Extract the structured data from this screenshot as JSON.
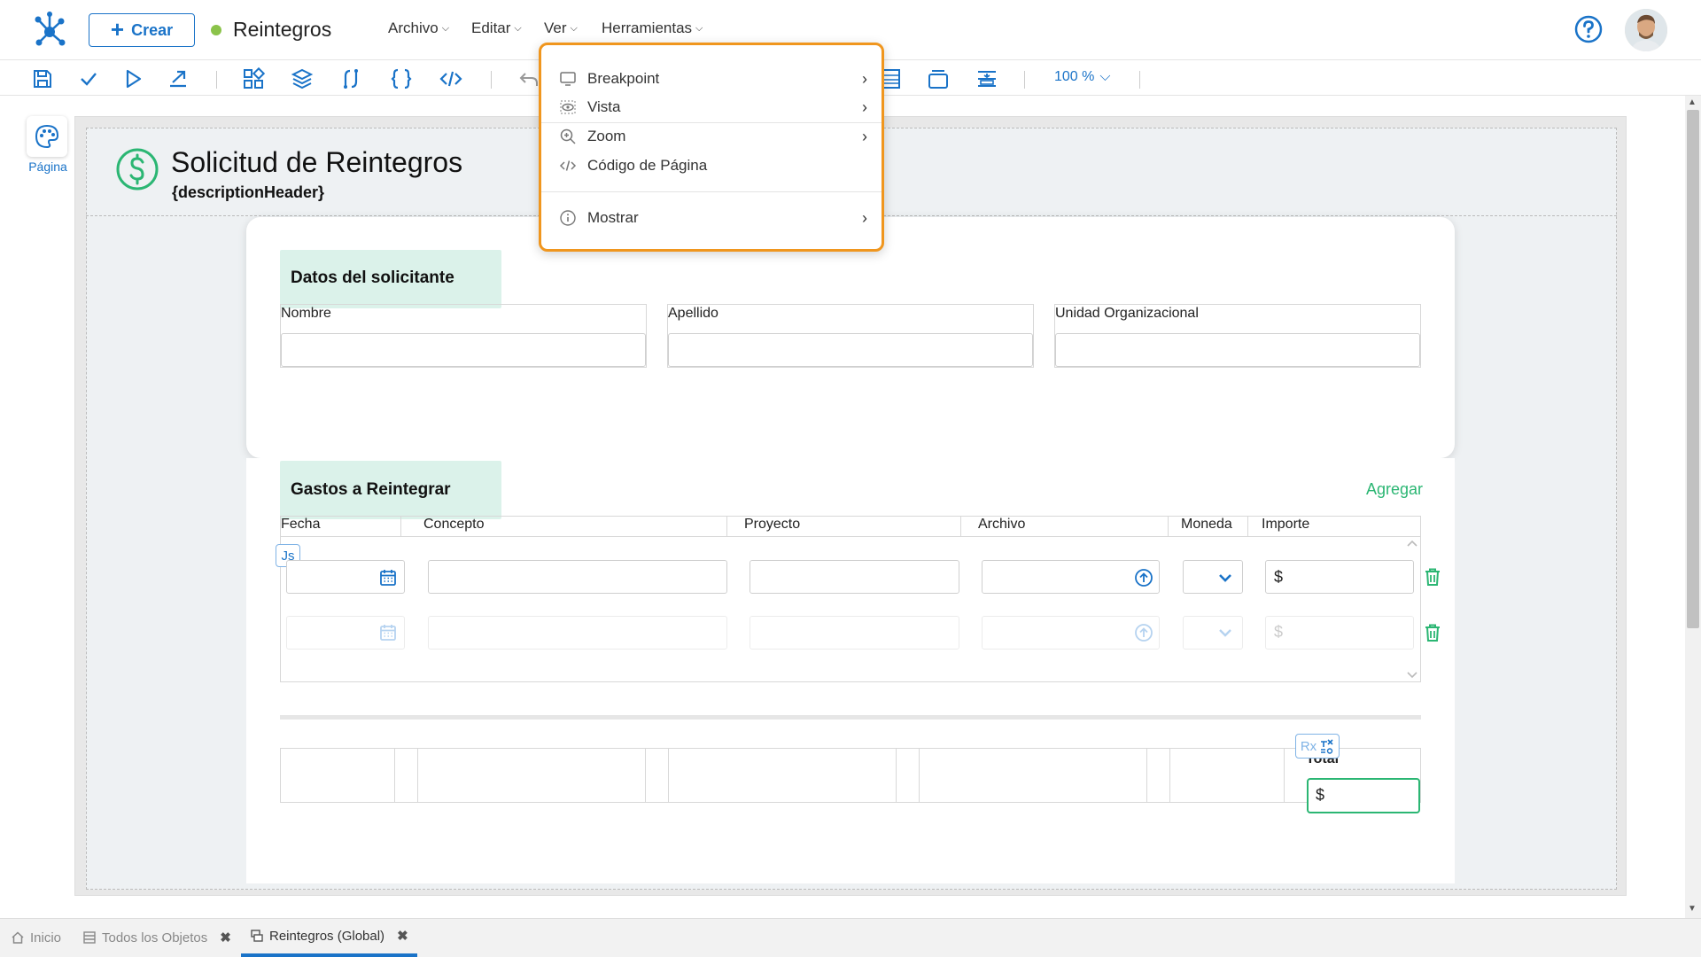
{
  "app": {
    "create_label": "Crear",
    "doc_title": "Reintegros",
    "status_color": "#8bc34a",
    "accent_color": "#1a73c8",
    "success_color": "#2bb673"
  },
  "menus": {
    "archivo": "Archivo",
    "editar": "Editar",
    "ver": "Ver",
    "herramientas": "Herramientas"
  },
  "toolbar": {
    "zoom": "100 %",
    "icons": [
      "save-icon",
      "check-icon",
      "play-icon",
      "export-icon",
      "components-icon",
      "layers-icon",
      "flow-icon",
      "braces-icon",
      "code-icon",
      "undo-icon",
      "table-icon",
      "window-icon",
      "align-icon"
    ]
  },
  "rail": {
    "page_label": "Página"
  },
  "ver_menu": {
    "items": [
      {
        "label": "Breakpoint",
        "icon": "monitor-icon",
        "has_submenu": true
      },
      {
        "label": "Vista",
        "icon": "eye-icon",
        "has_submenu": true
      },
      {
        "label": "Zoom",
        "icon": "zoom-in-icon",
        "has_submenu": true
      },
      {
        "label": "Código de Página",
        "icon": "code-icon",
        "has_submenu": false
      },
      {
        "label": "Mostrar",
        "icon": "info-icon",
        "has_submenu": true
      }
    ]
  },
  "page": {
    "title": "Solicitud de Reintegros",
    "subtitle": "{descriptionHeader}"
  },
  "section1": {
    "title": "Datos del solicitante",
    "fields": [
      {
        "label": "Nombre"
      },
      {
        "label": "Apellido"
      },
      {
        "label": "Unidad Organizacional"
      }
    ]
  },
  "section2": {
    "title": "Gastos a Reintegrar",
    "add_label": "Agregar",
    "columns": [
      "Fecha",
      "Concepto",
      "Proyecto",
      "Archivo",
      "Moneda",
      "Importe"
    ],
    "currency_symbol": "$",
    "js_badge": "Js"
  },
  "totals": {
    "label": "Total",
    "rx_badge": "Rx",
    "currency_symbol": "$"
  },
  "bottom_tabs": [
    {
      "label": "Inicio",
      "icon": "home-icon",
      "closable": false
    },
    {
      "label": "Todos los Objetos",
      "icon": "list-icon",
      "closable": true
    },
    {
      "label": "Reintegros (Global)",
      "icon": "form-icon",
      "closable": true,
      "active": true
    }
  ]
}
